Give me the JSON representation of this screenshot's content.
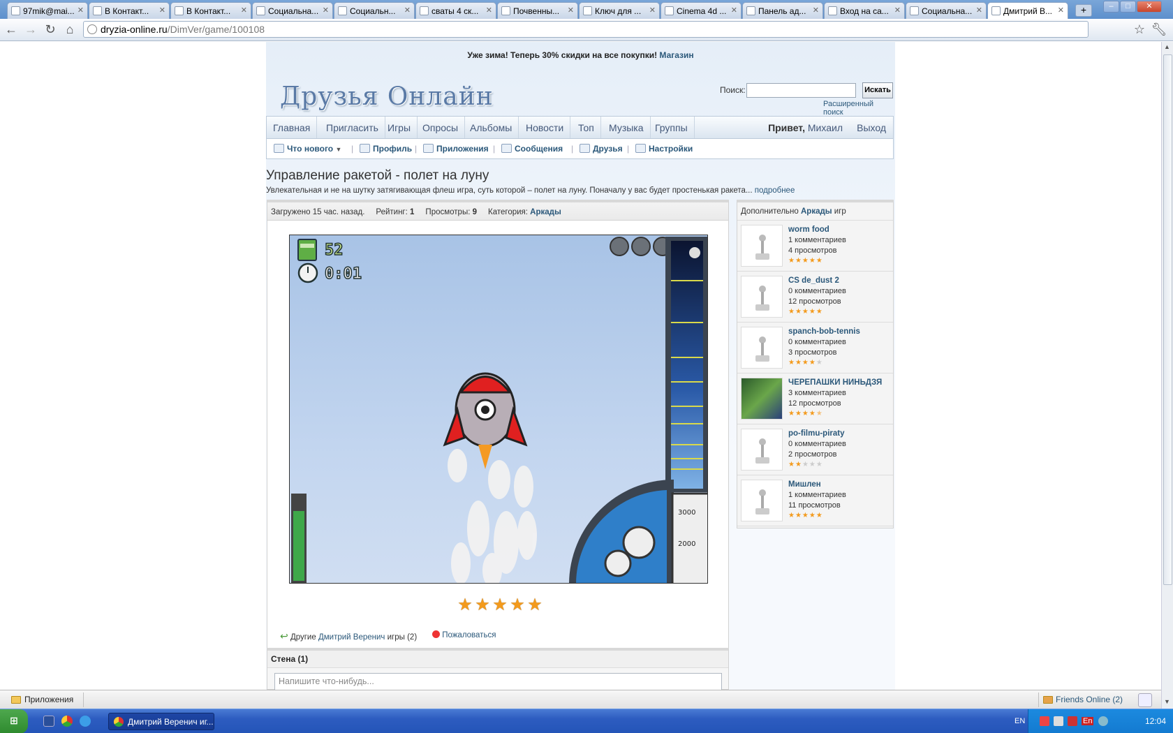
{
  "browser": {
    "tabs": [
      {
        "label": "97mik@mai..."
      },
      {
        "label": "В Контакт..."
      },
      {
        "label": "В Контакт..."
      },
      {
        "label": "Социальна..."
      },
      {
        "label": "Социальн..."
      },
      {
        "label": "сваты 4 ск..."
      },
      {
        "label": "Почвенны..."
      },
      {
        "label": "Ключ для ..."
      },
      {
        "label": "Cinema 4d ..."
      },
      {
        "label": "Панель ад..."
      },
      {
        "label": "Вход на са..."
      },
      {
        "label": "Социальна..."
      },
      {
        "label": "Дмитрий В..."
      }
    ],
    "new_tab": "+",
    "url_host": "dryzia-online.ru",
    "url_path": "/DimVer/game/100108"
  },
  "site": {
    "promo_text": "Уже зима! Теперь 30% скидки на все покупки!",
    "promo_link": "Магазин",
    "logo": "Друзья Онлайн",
    "search_label": "Поиск:",
    "search_button": "Искать",
    "advanced_search": "Расширенный поиск",
    "main_nav": [
      "Главная",
      "Пригласить",
      "Игры",
      "Опросы",
      "Альбомы",
      "Новости",
      "Топ",
      "Музыка",
      "Группы"
    ],
    "greeting": "Привет,",
    "user_name": "Михаил",
    "logout": "Выход",
    "sub_nav": [
      "Что нового",
      "Профиль",
      "Приложения",
      "Сообщения",
      "Друзья",
      "Настройки"
    ]
  },
  "game": {
    "title": "Управление ракетой - полет на луну",
    "description": "Увлекательная и не на шутку затягивающая флеш игра, суть которой – полет на луну. Поначалу у вас будет простенькая ракета...",
    "more_link": "подробнее",
    "uploaded": "Загружено 15 час. назад.",
    "rating_label": "Рейтинг:",
    "rating_value": "1",
    "views_label": "Просмотры:",
    "views_value": "9",
    "category_label": "Категория:",
    "category_value": "Аркады",
    "hud_money": "52",
    "hud_time": "0:01",
    "altitude_high": "3000",
    "altitude_low": "2000",
    "stars": 5,
    "others_prefix": "Другие",
    "others_author": "Дмитрий Веренич",
    "others_suffix": "игры (2)",
    "complain": "Пожаловаться",
    "wall_title": "Стена (1)",
    "wall_placeholder": "Напишите что-нибудь..."
  },
  "sidebar": {
    "head_prefix": "Дополнительно",
    "head_link": "Аркады",
    "head_suffix": "игр",
    "items": [
      {
        "name": "worm food",
        "comments": "1 комментариев",
        "views": "4 просмотров",
        "rating": 5
      },
      {
        "name": "CS de_dust 2",
        "comments": "0 комментариев",
        "views": "12 просмотров",
        "rating": 5
      },
      {
        "name": "spanch-bob-tennis",
        "comments": "0 комментариев",
        "views": "3 просмотров",
        "rating": 4
      },
      {
        "name": "ЧЕРЕПАШКИ НИНЬДЗЯ",
        "comments": "3 комментариев",
        "views": "12 просмотров",
        "rating": 4.5
      },
      {
        "name": "po-filmu-piraty",
        "comments": "0 комментариев",
        "views": "2 просмотров",
        "rating": 2
      },
      {
        "name": "Мишлен",
        "comments": "1 комментариев",
        "views": "11 просмотров",
        "rating": 5
      }
    ]
  },
  "statusbar": {
    "apps": "Приложения",
    "friends_online": "Friends Online (2)"
  },
  "taskbar": {
    "task_label": "Дмитрий Веренич иг...",
    "lang": "EN",
    "lang2": "En",
    "clock": "12:04"
  },
  "colors": {
    "link": "#2b587a",
    "star": "#f39a1c",
    "taskbar": "#2455b8"
  }
}
